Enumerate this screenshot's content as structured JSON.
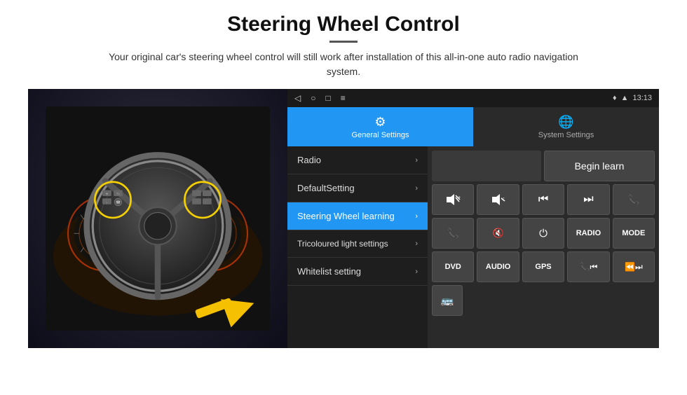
{
  "page": {
    "title": "Steering Wheel Control",
    "divider": true,
    "subtitle": "Your original car's steering wheel control will still work after installation of this all-in-one auto radio navigation system."
  },
  "screen": {
    "statusBar": {
      "time": "13:13",
      "navButtons": [
        "◁",
        "○",
        "□",
        "≡"
      ]
    },
    "tabs": [
      {
        "id": "general",
        "icon": "⚙",
        "label": "General Settings",
        "active": true
      },
      {
        "id": "system",
        "icon": "🌐",
        "label": "System Settings",
        "active": false
      }
    ],
    "menu": [
      {
        "id": "radio",
        "label": "Radio",
        "active": false
      },
      {
        "id": "default",
        "label": "DefaultSetting",
        "active": false
      },
      {
        "id": "steering",
        "label": "Steering Wheel learning",
        "active": true
      },
      {
        "id": "tricoloured",
        "label": "Tricoloured light settings",
        "active": false
      },
      {
        "id": "whitelist",
        "label": "Whitelist setting",
        "active": false
      }
    ],
    "controlPanel": {
      "beginLearnBtn": "Begin learn",
      "row1": [
        "🔊+",
        "🔊-",
        "⏮",
        "⏭",
        "📞"
      ],
      "row2": [
        "📞",
        "🔇",
        "⏻",
        "RADIO",
        "MODE"
      ],
      "row3": [
        "DVD",
        "AUDIO",
        "GPS",
        "📞⏮",
        "⏪⏭"
      ],
      "row4": [
        "🚌"
      ]
    }
  }
}
